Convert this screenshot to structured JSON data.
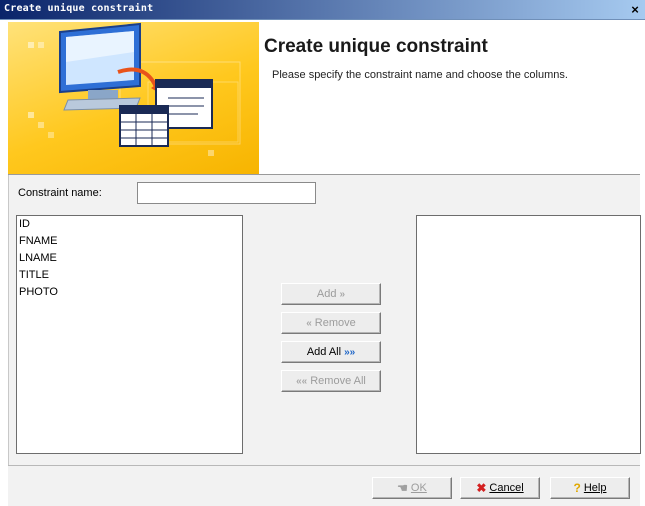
{
  "window": {
    "title": "Create unique constraint",
    "close_glyph": "×"
  },
  "header": {
    "title": "Create unique constraint",
    "subtitle": "Please specify the constraint name and choose the columns."
  },
  "form": {
    "constraint_label": "Constraint name:",
    "constraint_value": ""
  },
  "available_columns": [
    "ID",
    "FNAME",
    "LNAME",
    "TITLE",
    "PHOTO"
  ],
  "selected_columns": [],
  "transfer_buttons": {
    "add_label": "Add",
    "add_icon": "double-chevron-right-icon",
    "remove_label": "Remove",
    "remove_icon": "double-chevron-left-icon",
    "add_all_label": "Add All",
    "add_all_icon": "triple-chevron-right-icon",
    "remove_all_label": "Remove All",
    "remove_all_icon": "triple-chevron-left-icon"
  },
  "dialog_buttons": {
    "ok_label": "OK",
    "ok_icon": "hand-pointer-icon",
    "cancel_label": "Cancel",
    "cancel_icon": "red-x-icon",
    "help_label": "Help",
    "help_icon": "question-mark-icon"
  },
  "colors": {
    "banner": "#ffc81e",
    "titlebar": "#0a246a",
    "accent_blue": "#1f66c7"
  }
}
